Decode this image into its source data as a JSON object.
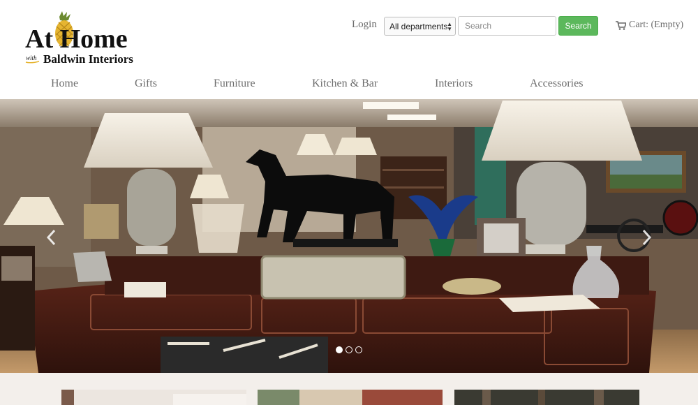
{
  "brand": {
    "line1": "At Home",
    "with": "with",
    "line2": "Baldwin Interiors",
    "colors": {
      "pineapple": "#e6b531",
      "text": "#111111"
    }
  },
  "header": {
    "login_label": "Login",
    "department_select": {
      "selected": "All departments"
    },
    "search": {
      "placeholder": "Search",
      "value": ""
    },
    "search_button_label": "Search",
    "cart": {
      "icon": "shopping-cart-icon",
      "label": "Cart: (Empty)"
    }
  },
  "nav": {
    "items": [
      {
        "label": "Home"
      },
      {
        "label": "Gifts"
      },
      {
        "label": "Furniture"
      },
      {
        "label": "Kitchen & Bar"
      },
      {
        "label": "Interiors"
      },
      {
        "label": "Accessories"
      }
    ]
  },
  "carousel": {
    "slide_count": 3,
    "active_index": 0,
    "prev_icon": "chevron-left-icon",
    "next_icon": "chevron-right-icon"
  },
  "colors": {
    "accent_button": "#5cb85c",
    "lower_background": "#f3efeb"
  }
}
